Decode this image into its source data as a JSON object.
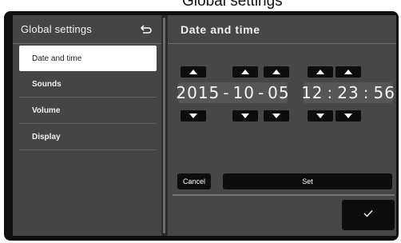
{
  "window_top_title": "Global settings",
  "sidebar": {
    "title": "Global settings",
    "items": [
      {
        "label": "Date and time",
        "active": true
      },
      {
        "label": "Sounds",
        "active": false
      },
      {
        "label": "Volume",
        "active": false
      },
      {
        "label": "Display",
        "active": false
      }
    ]
  },
  "main": {
    "title": "Date and time",
    "date": {
      "year": "2015",
      "month": "10",
      "day": "05",
      "sep": "-"
    },
    "time": {
      "hour": "12",
      "minute": "23",
      "second": "56",
      "sep": ":"
    }
  },
  "buttons": {
    "cancel": "Cancel",
    "set": "Set"
  },
  "colors": {
    "panel": "#474747",
    "button": "#0d0d0d",
    "active_item": "#ffffff"
  },
  "icons": {
    "back": "back-arrow-icon",
    "confirm": "checkmark-icon",
    "increment": "triangle-up-icon",
    "decrement": "triangle-down-icon"
  }
}
